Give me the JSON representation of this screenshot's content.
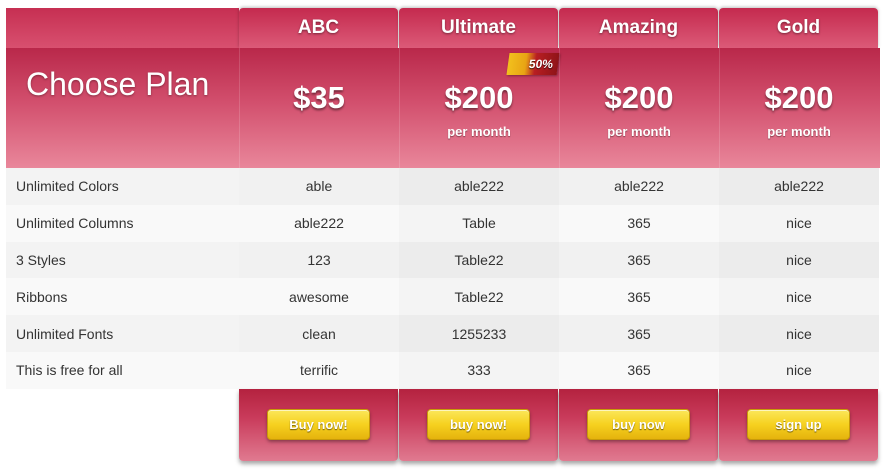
{
  "table": {
    "title": "Choose Plan",
    "plans": [
      {
        "name": "ABC",
        "price": "$35",
        "period": "",
        "ribbon": "",
        "button": "Buy now!"
      },
      {
        "name": "Ultimate",
        "price": "$200",
        "period": "per month",
        "ribbon": "50%",
        "button": "buy now!"
      },
      {
        "name": "Amazing",
        "price": "$200",
        "period": "per month",
        "ribbon": "",
        "button": "buy now"
      },
      {
        "name": "Gold",
        "price": "$200",
        "period": "per month",
        "ribbon": "",
        "button": "sign up"
      }
    ],
    "features": [
      {
        "label": "Unlimited Colors",
        "values": [
          "able",
          "able222",
          "able222",
          "able222"
        ]
      },
      {
        "label": "Unlimited Columns",
        "values": [
          "able222",
          "Table",
          "365",
          "nice"
        ]
      },
      {
        "label": "3 Styles",
        "values": [
          "123",
          "Table22",
          "365",
          "nice"
        ]
      },
      {
        "label": "Ribbons",
        "values": [
          "awesome",
          "Table22",
          "365",
          "nice"
        ]
      },
      {
        "label": "Unlimited Fonts",
        "values": [
          "clean",
          "1255233",
          "365",
          "nice"
        ]
      },
      {
        "label": "This is free for all",
        "values": [
          "terrific",
          "333",
          "365",
          "nice"
        ]
      }
    ]
  },
  "colors": {
    "header_crimson": "#c42a4e",
    "header_pink": "#e9879b",
    "button_yellow": "#f6d11f",
    "ribbon_gold": "#f2c01d",
    "ribbon_red": "#b81e22"
  }
}
